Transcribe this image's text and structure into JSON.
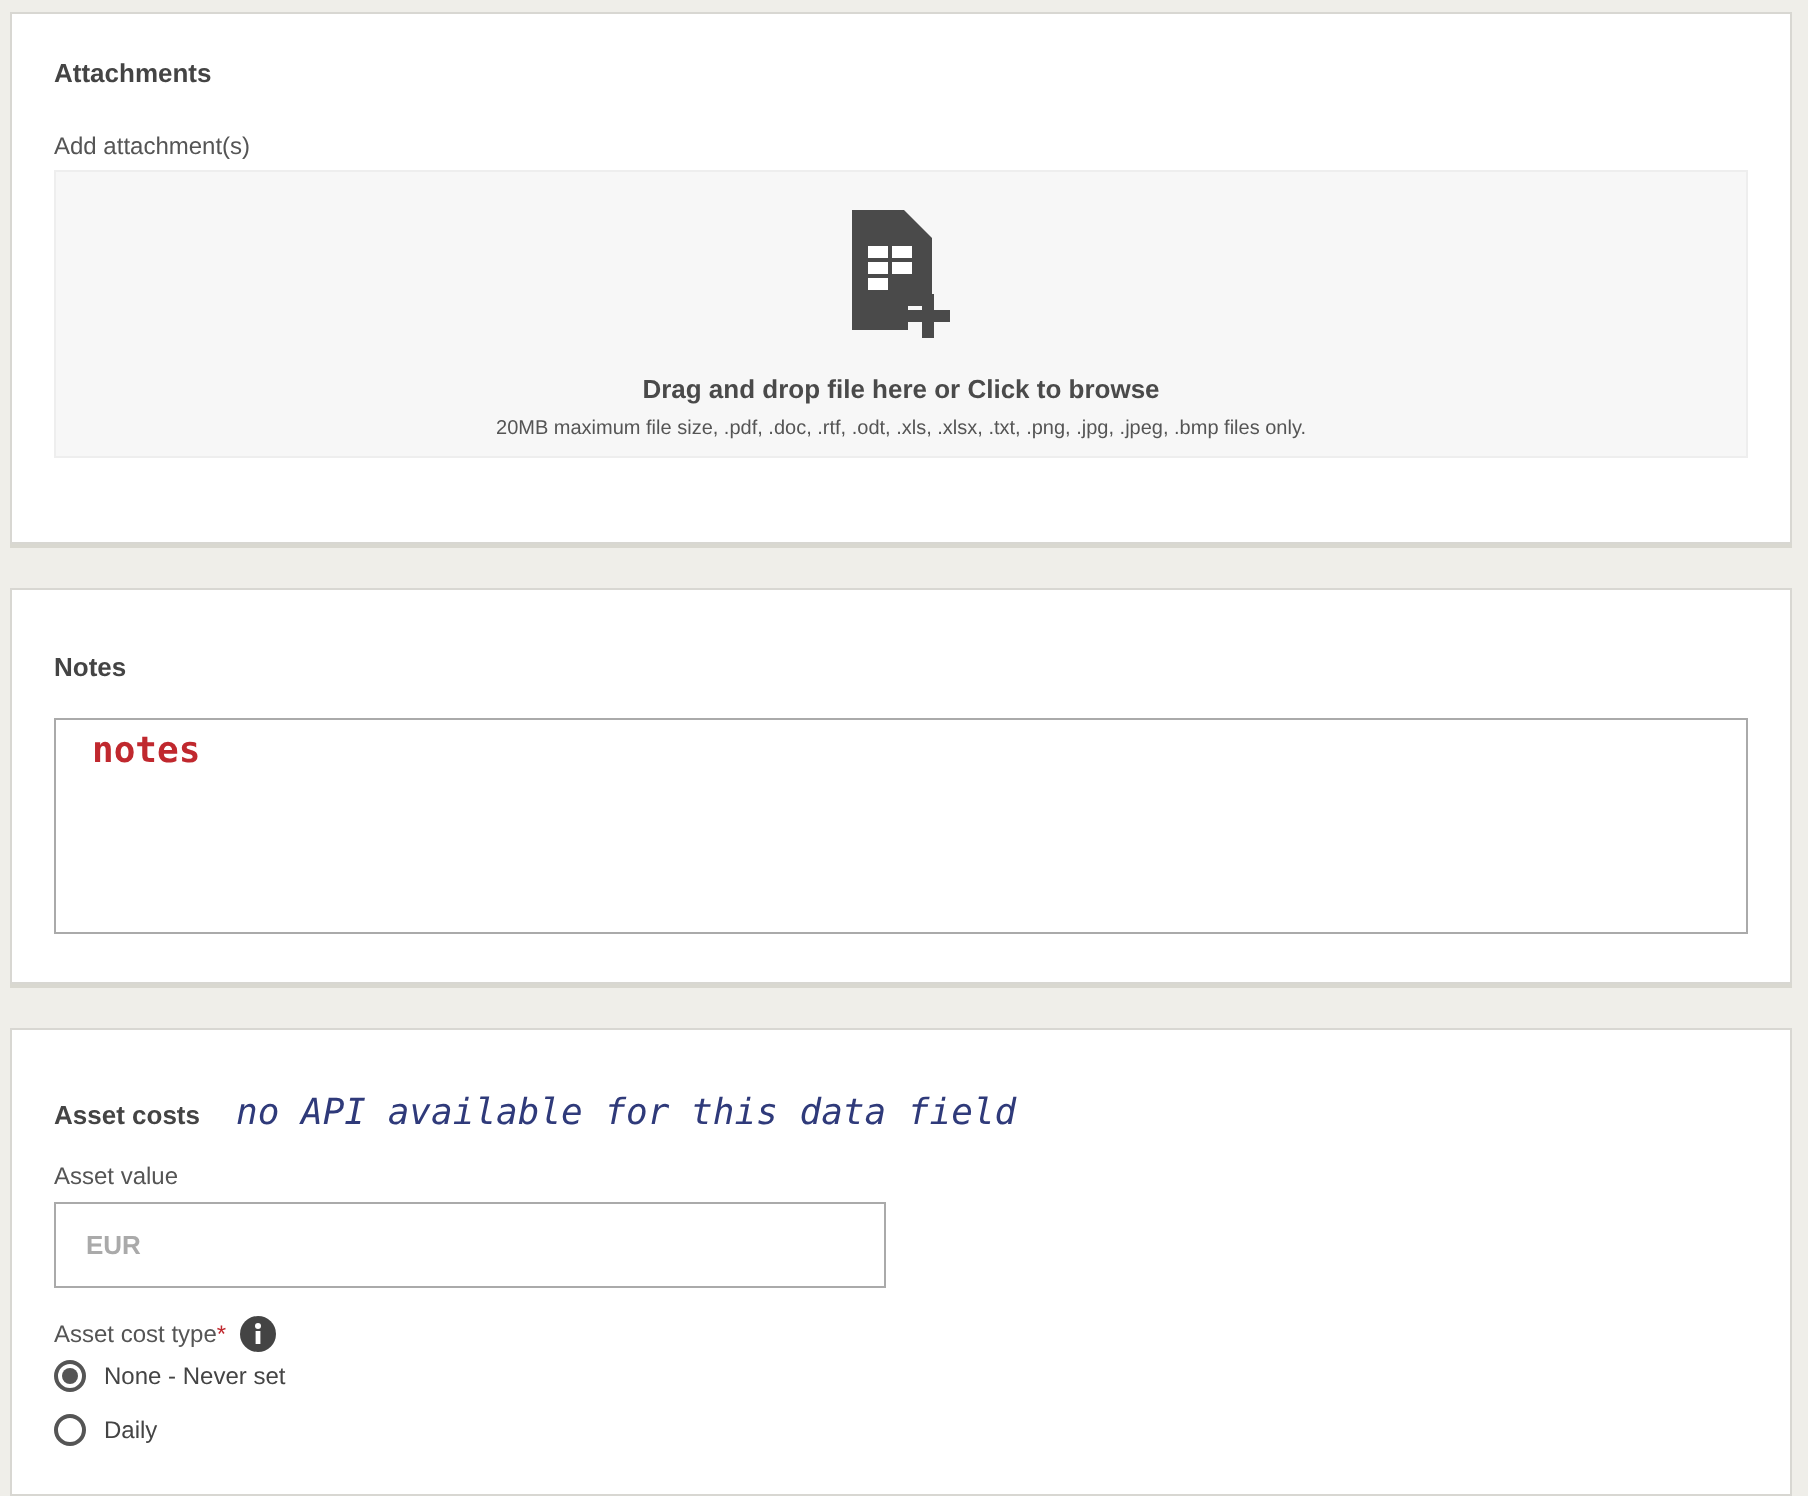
{
  "attachments": {
    "title": "Attachments",
    "label": "Add attachment(s)",
    "dropzone": {
      "headline": "Drag and drop file here or Click to browse",
      "hint": "20MB maximum file size, .pdf, .doc, .rtf, .odt, .xls, .xlsx, .txt, .png, .jpg, .jpeg, .bmp files only."
    }
  },
  "notes": {
    "title": "Notes",
    "value": "notes"
  },
  "asset_costs": {
    "title": "Asset costs",
    "annotation": "no API available for this data field",
    "asset_value": {
      "label": "Asset value",
      "placeholder": "EUR"
    },
    "cost_type": {
      "label": "Asset cost type",
      "required_mark": "*",
      "options": [
        {
          "label": "None - Never set",
          "selected": true
        },
        {
          "label": "Daily",
          "selected": false
        }
      ]
    }
  }
}
